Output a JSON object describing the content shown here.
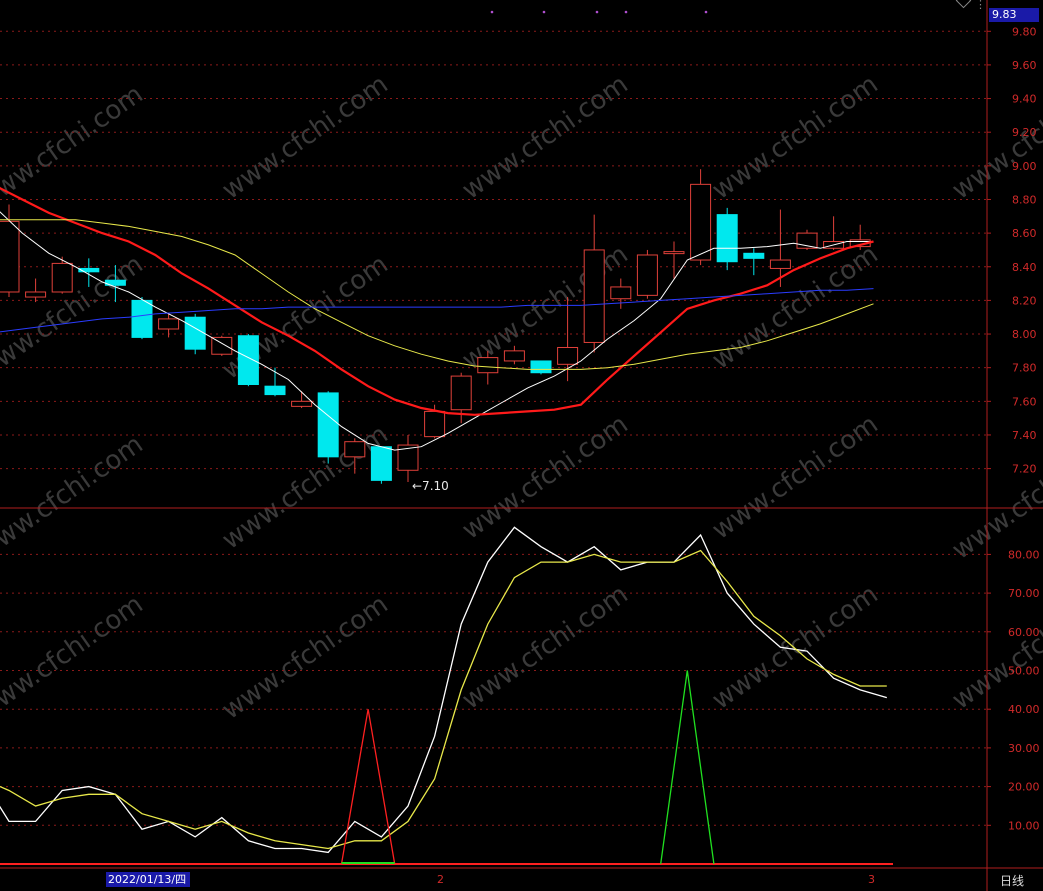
{
  "price_box": "9.83",
  "date_label": "2022/01/13/四",
  "month_marks": [
    "2",
    "3"
  ],
  "period_button": "日线",
  "low_label": "←7.10",
  "colors": {
    "up": "#e0413a",
    "down": "#00e8ee",
    "ma5": "#ffffff",
    "ma10": "#ff1a1a",
    "ma20": "#e8e84a",
    "ma60": "#2a3cff",
    "grid": "#8b1a1a",
    "axis": "#b01e1e",
    "kdj_k": "#ffffff",
    "kdj_d": "#e8e84a",
    "signal_buy": "#ff2020",
    "signal_sell": "#20e020",
    "watermark": "#3a3a3a"
  },
  "watermark_text": "www.cfchi.com",
  "chart_data": [
    {
      "type": "candlestick",
      "ylim": [
        7.0,
        9.9
      ],
      "y_ticks": [
        "9.80",
        "9.60",
        "9.40",
        "9.20",
        "9.00",
        "8.80",
        "8.60",
        "8.40",
        "8.20",
        "8.00",
        "7.80",
        "7.60",
        "7.40",
        "7.20"
      ],
      "candles": [
        {
          "o": 8.25,
          "c": 8.67,
          "h": 8.77,
          "l": 8.22
        },
        {
          "o": 8.22,
          "c": 8.25,
          "h": 8.33,
          "l": 8.19
        },
        {
          "o": 8.25,
          "c": 8.42,
          "h": 8.46,
          "l": 8.24
        },
        {
          "o": 8.39,
          "c": 8.37,
          "h": 8.45,
          "l": 8.28
        },
        {
          "o": 8.32,
          "c": 8.29,
          "h": 8.41,
          "l": 8.19
        },
        {
          "o": 8.2,
          "c": 7.98,
          "h": 8.22,
          "l": 7.97
        },
        {
          "o": 8.03,
          "c": 8.09,
          "h": 8.12,
          "l": 7.98
        },
        {
          "o": 8.1,
          "c": 7.91,
          "h": 8.12,
          "l": 7.88
        },
        {
          "o": 7.88,
          "c": 7.98,
          "h": 7.99,
          "l": 7.87
        },
        {
          "o": 7.99,
          "c": 7.7,
          "h": 8.0,
          "l": 7.69
        },
        {
          "o": 7.69,
          "c": 7.64,
          "h": 7.8,
          "l": 7.63
        },
        {
          "o": 7.57,
          "c": 7.6,
          "h": 7.66,
          "l": 7.56
        },
        {
          "o": 7.65,
          "c": 7.27,
          "h": 7.66,
          "l": 7.23
        },
        {
          "o": 7.27,
          "c": 7.36,
          "h": 7.38,
          "l": 7.17
        },
        {
          "o": 7.33,
          "c": 7.13,
          "h": 7.33,
          "l": 7.11
        },
        {
          "o": 7.19,
          "c": 7.34,
          "h": 7.4,
          "l": 7.12
        },
        {
          "o": 7.39,
          "c": 7.54,
          "h": 7.58,
          "l": 7.38
        },
        {
          "o": 7.55,
          "c": 7.75,
          "h": 7.77,
          "l": 7.47
        },
        {
          "o": 7.77,
          "c": 7.86,
          "h": 7.9,
          "l": 7.7
        },
        {
          "o": 7.84,
          "c": 7.9,
          "h": 7.93,
          "l": 7.82
        },
        {
          "o": 7.84,
          "c": 7.77,
          "h": 7.84,
          "l": 7.76
        },
        {
          "o": 7.82,
          "c": 7.92,
          "h": 8.22,
          "l": 7.72
        },
        {
          "o": 7.95,
          "c": 8.5,
          "h": 8.71,
          "l": 7.89
        },
        {
          "o": 8.21,
          "c": 8.28,
          "h": 8.33,
          "l": 8.15
        },
        {
          "o": 8.23,
          "c": 8.47,
          "h": 8.5,
          "l": 8.21
        },
        {
          "o": 8.48,
          "c": 8.49,
          "h": 8.55,
          "l": 8.33
        },
        {
          "o": 8.44,
          "c": 8.89,
          "h": 8.98,
          "l": 8.41
        },
        {
          "o": 8.71,
          "c": 8.43,
          "h": 8.75,
          "l": 8.38
        },
        {
          "o": 8.48,
          "c": 8.45,
          "h": 8.51,
          "l": 8.35
        },
        {
          "o": 8.39,
          "c": 8.44,
          "h": 8.74,
          "l": 8.28
        },
        {
          "o": 8.51,
          "c": 8.6,
          "h": 8.62,
          "l": 8.5
        },
        {
          "o": 8.51,
          "c": 8.55,
          "h": 8.7,
          "l": 8.5
        },
        {
          "o": 8.52,
          "c": 8.56,
          "h": 8.65,
          "l": 8.5
        }
      ],
      "series": [
        {
          "name": "MA5",
          "values": [
            8.75,
            8.6,
            8.48,
            8.4,
            8.31,
            8.25,
            8.16,
            8.08,
            7.99,
            7.9,
            7.82,
            7.73,
            7.58,
            7.45,
            7.35,
            7.31,
            7.33,
            7.41,
            7.5,
            7.59,
            7.68,
            7.75,
            7.84,
            7.97,
            8.08,
            8.21,
            8.44,
            8.51,
            8.51,
            8.52,
            8.54,
            8.51,
            8.55,
            8.55
          ]
        },
        {
          "name": "MA10",
          "values": [
            8.88,
            8.8,
            8.72,
            8.66,
            8.6,
            8.55,
            8.47,
            8.36,
            8.27,
            8.17,
            8.07,
            7.99,
            7.9,
            7.79,
            7.69,
            7.61,
            7.56,
            7.53,
            7.52,
            7.53,
            7.54,
            7.55,
            7.58,
            7.73,
            7.87,
            8.01,
            8.15,
            8.2,
            8.24,
            8.29,
            8.38,
            8.45,
            8.51,
            8.55
          ]
        },
        {
          "name": "MA20",
          "values": [
            8.68,
            8.68,
            8.68,
            8.68,
            8.66,
            8.64,
            8.61,
            8.58,
            8.53,
            8.47,
            8.36,
            8.25,
            8.15,
            8.07,
            7.99,
            7.93,
            7.88,
            7.84,
            7.81,
            7.8,
            7.79,
            7.79,
            7.79,
            7.8,
            7.82,
            7.85,
            7.88,
            7.9,
            7.92,
            7.96,
            8.01,
            8.06,
            8.12,
            8.18
          ]
        },
        {
          "name": "MA60",
          "values": [
            8.01,
            8.03,
            8.05,
            8.07,
            8.09,
            8.1,
            8.12,
            8.13,
            8.14,
            8.15,
            8.15,
            8.16,
            8.16,
            8.16,
            8.16,
            8.16,
            8.16,
            8.16,
            8.16,
            8.16,
            8.17,
            8.17,
            8.17,
            8.18,
            8.19,
            8.2,
            8.21,
            8.22,
            8.23,
            8.24,
            8.25,
            8.26,
            8.26,
            8.27
          ]
        }
      ]
    },
    {
      "type": "line",
      "ylim": [
        0,
        93
      ],
      "y_ticks": [
        "80.00",
        "70.00",
        "60.00",
        "50.00",
        "40.00",
        "30.00",
        "20.00",
        "10.00"
      ],
      "series": [
        {
          "name": "K",
          "values": [
            22,
            11,
            11,
            19,
            20,
            18,
            9,
            11,
            7,
            12,
            6,
            4,
            4,
            3,
            11,
            7,
            15,
            33,
            62,
            78,
            87,
            82,
            78,
            82,
            76,
            78,
            78,
            85,
            70,
            62,
            56,
            55,
            48,
            45,
            43
          ]
        },
        {
          "name": "D",
          "values": [
            22,
            19,
            15,
            17,
            18,
            18,
            13,
            11,
            9,
            11,
            8,
            6,
            5,
            4,
            6,
            6,
            11,
            22,
            45,
            62,
            74,
            78,
            78,
            80,
            78,
            78,
            78,
            81,
            73,
            64,
            59,
            53,
            49,
            46,
            46
          ]
        },
        {
          "name": "buy-signal",
          "x": [
            13.5,
            14.5,
            15.5
          ],
          "values": [
            0,
            40,
            0
          ]
        },
        {
          "name": "sell-signal",
          "x": [
            25.5,
            26.5,
            27.5
          ],
          "values": [
            0,
            50,
            0
          ]
        }
      ]
    }
  ]
}
